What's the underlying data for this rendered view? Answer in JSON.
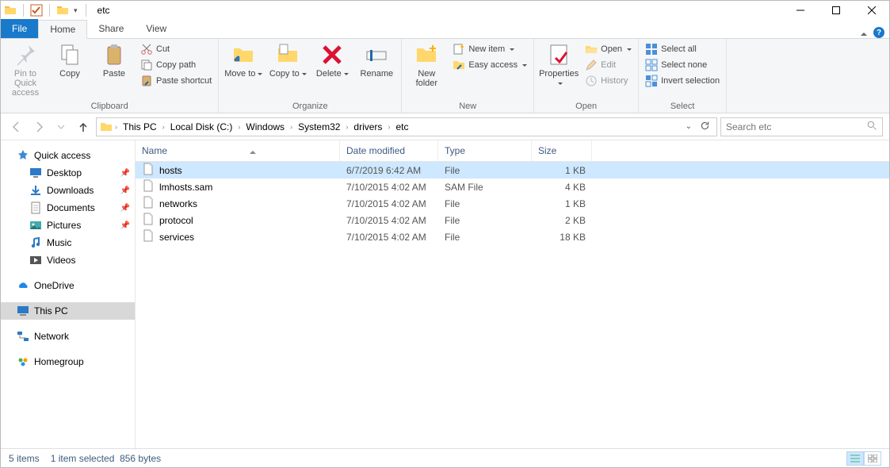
{
  "window": {
    "title": "etc"
  },
  "tabs": {
    "file": "File",
    "home": "Home",
    "share": "Share",
    "view": "View"
  },
  "ribbon": {
    "clipboard": {
      "label": "Clipboard",
      "pin": "Pin to Quick access",
      "copy": "Copy",
      "paste": "Paste",
      "cut": "Cut",
      "copypath": "Copy path",
      "pasteshortcut": "Paste shortcut"
    },
    "organize": {
      "label": "Organize",
      "moveto": "Move to",
      "copyto": "Copy to",
      "delete": "Delete",
      "rename": "Rename"
    },
    "new": {
      "label": "New",
      "newfolder": "New folder",
      "newitem": "New item",
      "easyaccess": "Easy access"
    },
    "open": {
      "label": "Open",
      "properties": "Properties",
      "open": "Open",
      "edit": "Edit",
      "history": "History"
    },
    "select": {
      "label": "Select",
      "selectall": "Select all",
      "selectnone": "Select none",
      "invert": "Invert selection"
    }
  },
  "breadcrumbs": [
    "This PC",
    "Local Disk (C:)",
    "Windows",
    "System32",
    "drivers",
    "etc"
  ],
  "search": {
    "placeholder": "Search etc"
  },
  "columns": {
    "name": "Name",
    "date": "Date modified",
    "type": "Type",
    "size": "Size"
  },
  "files": [
    {
      "name": "hosts",
      "date": "6/7/2019 6:42 AM",
      "type": "File",
      "size": "1 KB",
      "selected": true
    },
    {
      "name": "lmhosts.sam",
      "date": "7/10/2015 4:02 AM",
      "type": "SAM File",
      "size": "4 KB",
      "selected": false
    },
    {
      "name": "networks",
      "date": "7/10/2015 4:02 AM",
      "type": "File",
      "size": "1 KB",
      "selected": false
    },
    {
      "name": "protocol",
      "date": "7/10/2015 4:02 AM",
      "type": "File",
      "size": "2 KB",
      "selected": false
    },
    {
      "name": "services",
      "date": "7/10/2015 4:02 AM",
      "type": "File",
      "size": "18 KB",
      "selected": false
    }
  ],
  "nav": {
    "quickaccess": "Quick access",
    "desktop": "Desktop",
    "downloads": "Downloads",
    "documents": "Documents",
    "pictures": "Pictures",
    "music": "Music",
    "videos": "Videos",
    "onedrive": "OneDrive",
    "thispc": "This PC",
    "network": "Network",
    "homegroup": "Homegroup"
  },
  "status": {
    "count": "5 items",
    "selection": "1 item selected",
    "bytes": "856 bytes"
  }
}
